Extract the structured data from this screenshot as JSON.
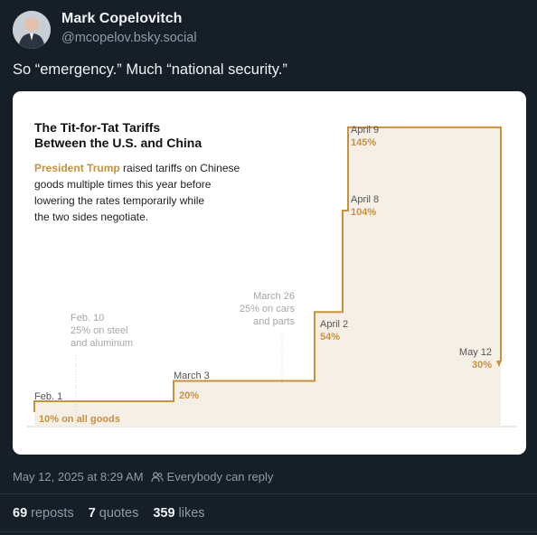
{
  "post": {
    "author_name": "Mark Copelovitch",
    "author_handle": "@mcopelov.bsky.social",
    "text": "So “emergency.” Much “national security.”",
    "timestamp": "May 12, 2025 at 8:29 AM",
    "reply_setting": "Everybody can reply",
    "reposts_count": "69",
    "reposts_label": "reposts",
    "quotes_count": "7",
    "quotes_label": "quotes",
    "likes_count": "359",
    "likes_label": "likes"
  },
  "colors": {
    "background": "#161e27",
    "muted": "#8d9cab",
    "tariff_line": "#c7913f"
  },
  "chart": {
    "title_line1": "The Tit-for-Tat Tariffs",
    "title_line2": "Between the U.S. and China",
    "desc_highlight": "President Trump",
    "desc_line1_rest": " raised tariffs on Chinese",
    "desc_line2": "goods multiple times this year before",
    "desc_line3": "lowering the rates temporarily while",
    "desc_line4": "the two sides negotiate."
  },
  "chart_data": {
    "type": "line",
    "title": "The Tit-for-Tat Tariffs Between the U.S. and China",
    "x": [
      "Feb. 1",
      "Feb. 10",
      "March 3",
      "March 26",
      "April 2",
      "April 8",
      "April 9",
      "May 12"
    ],
    "y": [
      10,
      10,
      20,
      20,
      54,
      104,
      145,
      30
    ],
    "unit": "%",
    "step": true,
    "events": [
      {
        "date": "Feb. 1",
        "value_label": "10% on all goods"
      },
      {
        "date": "Feb. 10",
        "note_lines": [
          "25% on steel",
          "and aluminum"
        ]
      },
      {
        "date": "March 3",
        "value_label": "20%"
      },
      {
        "date": "March 26",
        "note_lines": [
          "25% on cars",
          "and parts"
        ]
      },
      {
        "date": "April 2",
        "value_label": "54%"
      },
      {
        "date": "April 8",
        "value_label": "104%"
      },
      {
        "date": "April 9",
        "value_label": "145%"
      },
      {
        "date": "May 12",
        "value_label": "30%"
      }
    ]
  }
}
